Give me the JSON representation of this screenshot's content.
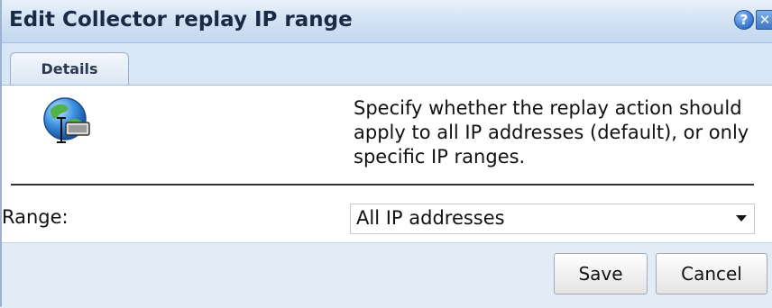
{
  "dialog": {
    "title": "Edit Collector replay IP range",
    "help_icon": "question-icon",
    "close_icon": "close-icon",
    "help_glyph": "?",
    "close_glyph": "✕"
  },
  "tabs": [
    {
      "label": "Details",
      "selected": true
    }
  ],
  "content": {
    "icon": "globe-network-icon",
    "description": "Specify whether the replay action should apply to all IP addresses (default), or only specific IP ranges.",
    "range_label": "Range:",
    "range_value": "All IP addresses"
  },
  "footer": {
    "save_label": "Save",
    "cancel_label": "Cancel"
  }
}
